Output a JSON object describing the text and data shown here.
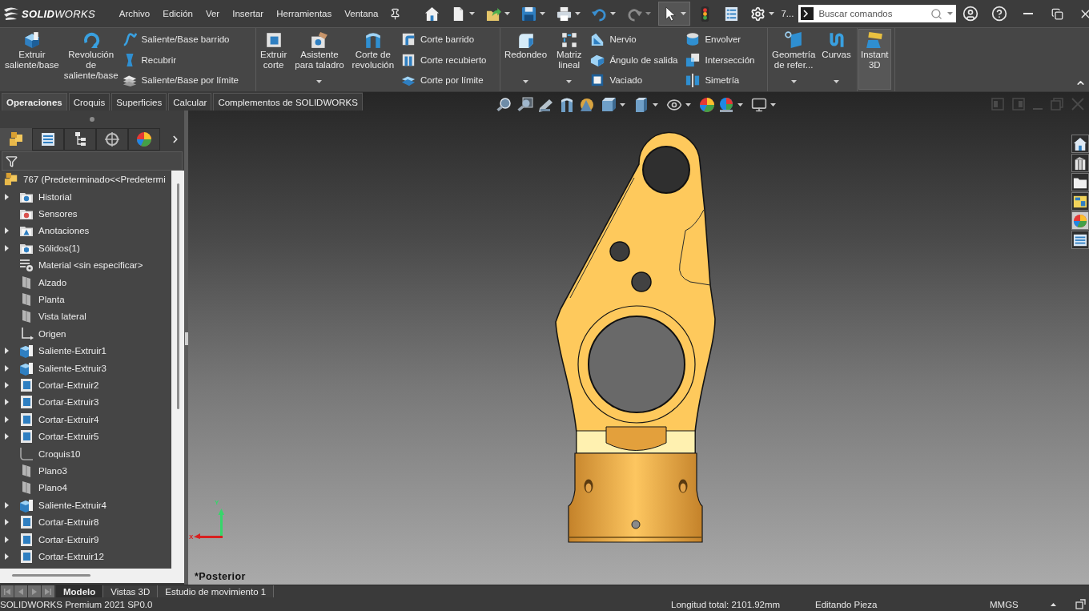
{
  "title_bar": {
    "logo": "**SOLID**WORKS",
    "menu": [
      "Archivo",
      "Edición",
      "Ver",
      "Insertar",
      "Herramientas",
      "Ventana"
    ],
    "quick_access": [
      {
        "dropdown": false,
        "disabled": false,
        "pressed": false
      },
      {
        "dropdown": true,
        "disabled": false,
        "pressed": false
      },
      {
        "dropdown": true,
        "disabled": false,
        "pressed": false
      },
      {
        "dropdown": true,
        "disabled": false,
        "pressed": false
      },
      {
        "dropdown": true,
        "disabled": false,
        "pressed": false
      },
      {
        "dropdown": true,
        "disabled": false,
        "pressed": false
      },
      {
        "dropdown": true,
        "disabled": true,
        "pressed": false
      },
      {
        "dropdown": true,
        "disabled": false,
        "pressed": true
      },
      {
        "dropdown": false,
        "disabled": false,
        "pressed": false
      },
      {
        "dropdown": false,
        "disabled": false,
        "pressed": false
      },
      {
        "dropdown": true,
        "disabled": false,
        "pressed": false
      }
    ],
    "overflow": "7...",
    "search": {
      "placeholder": "Buscar comandos"
    }
  },
  "ribbon": {
    "groups": [
      {
        "items": [
          {
            "kind": "large",
            "lines": [
              "Extruir",
              "saliente/base"
            ],
            "dropdown": false,
            "pressed": false
          },
          {
            "kind": "large",
            "lines": [
              "Revolución",
              "de",
              "saliente/base"
            ],
            "dropdown": false,
            "pressed": false
          },
          {
            "kind": "stack",
            "entries": [
              "Saliente/Base barrido",
              "Recubrir",
              "Saliente/Base por límite"
            ]
          }
        ]
      },
      {
        "items": [
          {
            "kind": "large",
            "lines": [
              "Extruir",
              "corte"
            ],
            "dropdown": false,
            "pressed": false
          },
          {
            "kind": "large",
            "lines": [
              "Asistente",
              "para taladro"
            ],
            "dropdown": true,
            "pressed": false
          },
          {
            "kind": "large",
            "lines": [
              "Corte de",
              "revolución"
            ],
            "dropdown": false,
            "pressed": false
          },
          {
            "kind": "stack",
            "entries": [
              "Corte barrido",
              "Corte recubierto",
              "Corte por límite"
            ]
          }
        ]
      },
      {
        "items": [
          {
            "kind": "large",
            "lines": [
              "Redondeo"
            ],
            "dropdown": true,
            "pressed": false
          },
          {
            "kind": "large",
            "lines": [
              "Matriz",
              "lineal"
            ],
            "dropdown": true,
            "pressed": false
          },
          {
            "kind": "stack",
            "entries": [
              "Nervio",
              "Ángulo de salida",
              "Vaciado"
            ]
          },
          {
            "kind": "stack",
            "entries": [
              "Envolver",
              "Intersección",
              "Simetría"
            ]
          }
        ]
      },
      {
        "items": [
          {
            "kind": "large",
            "lines": [
              "Geometría",
              "de refer..."
            ],
            "dropdown": true,
            "pressed": false
          },
          {
            "kind": "large",
            "lines": [
              "Curvas"
            ],
            "dropdown": true,
            "pressed": false
          }
        ]
      },
      {
        "items": [
          {
            "kind": "large",
            "lines": [
              "Instant",
              "3D"
            ],
            "dropdown": false,
            "pressed": true
          }
        ]
      }
    ]
  },
  "command_tabs": [
    {
      "label": "Operaciones",
      "selected": true
    },
    {
      "label": "Croquis",
      "selected": false
    },
    {
      "label": "Superficies",
      "selected": false
    },
    {
      "label": "Calcular",
      "selected": false
    },
    {
      "label": "Complementos de SOLIDWORKS",
      "selected": false
    }
  ],
  "manager_tabs": [
    {
      "selected": true
    },
    {
      "selected": false
    },
    {
      "selected": false
    },
    {
      "selected": false
    },
    {
      "selected": false
    }
  ],
  "feature_tree": {
    "root": "767 (Predeterminado<<Predetermi",
    "items": [
      {
        "label": "Historial",
        "kind": "history",
        "expandable": true
      },
      {
        "label": "Sensores",
        "kind": "sensors",
        "expandable": false
      },
      {
        "label": "Anotaciones",
        "kind": "annotations",
        "expandable": true
      },
      {
        "label": "Sólidos(1)",
        "kind": "solids",
        "expandable": true
      },
      {
        "label": "Material <sin especificar>",
        "kind": "material",
        "expandable": false
      },
      {
        "label": "Alzado",
        "kind": "plane",
        "expandable": false
      },
      {
        "label": "Planta",
        "kind": "plane",
        "expandable": false
      },
      {
        "label": "Vista lateral",
        "kind": "plane",
        "expandable": false
      },
      {
        "label": "Origen",
        "kind": "origin",
        "expandable": false
      },
      {
        "label": "Saliente-Extruir1",
        "kind": "boss",
        "expandable": true
      },
      {
        "label": "Saliente-Extruir3",
        "kind": "boss",
        "expandable": true
      },
      {
        "label": "Cortar-Extruir2",
        "kind": "cut",
        "expandable": true
      },
      {
        "label": "Cortar-Extruir3",
        "kind": "cut",
        "expandable": true
      },
      {
        "label": "Cortar-Extruir4",
        "kind": "cut",
        "expandable": true
      },
      {
        "label": "Cortar-Extruir5",
        "kind": "cut",
        "expandable": true
      },
      {
        "label": "Croquis10",
        "kind": "sketch",
        "expandable": false
      },
      {
        "label": "Plano3",
        "kind": "plane",
        "expandable": false
      },
      {
        "label": "Plano4",
        "kind": "plane",
        "expandable": false
      },
      {
        "label": "Saliente-Extruir4",
        "kind": "boss",
        "expandable": true
      },
      {
        "label": "Cortar-Extruir8",
        "kind": "cut",
        "expandable": true
      },
      {
        "label": "Cortar-Extruir9",
        "kind": "cut",
        "expandable": true
      },
      {
        "label": "Cortar-Extruir12",
        "kind": "cut",
        "expandable": true
      }
    ]
  },
  "viewport": {
    "view_name": "*Posterior",
    "axis_labels": {
      "x": "X",
      "y": "Y"
    },
    "task_pane": [
      {
        "selected": false
      },
      {
        "selected": false
      },
      {
        "selected": false
      },
      {
        "selected": false
      },
      {
        "selected": true
      },
      {
        "selected": false
      }
    ]
  },
  "bottom_tabs": [
    {
      "label": "Modelo",
      "selected": true
    },
    {
      "label": "Vistas 3D",
      "selected": false
    },
    {
      "label": "Estudio de movimiento 1",
      "selected": false
    }
  ],
  "status_bar": {
    "product": "SOLIDWORKS Premium 2021 SP0.0",
    "length": "Longitud total: 2101.92mm",
    "mode": "Editando Pieza",
    "units": "MMGS"
  }
}
